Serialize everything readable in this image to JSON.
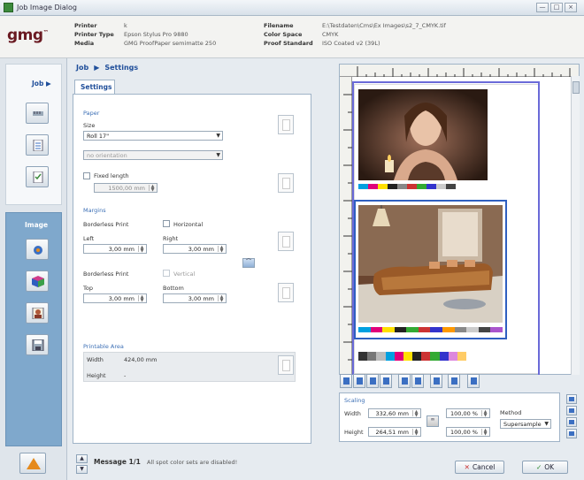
{
  "window": {
    "title": "Job Image Dialog",
    "min": "—",
    "max": "□",
    "close": "×"
  },
  "header": {
    "logo": "gmg",
    "printer_label": "Printer",
    "printer_value": "k",
    "printer_type_label": "Printer Type",
    "printer_type_value": "Epson Stylus Pro 9880",
    "media_label": "Media",
    "media_value": "GMG ProofPaper semimatte 250",
    "filename_label": "Filename",
    "filename_value": "E:\\Testdaten\\Cms\\Ex Images\\s2_7_CMYK.tif",
    "color_space_label": "Color Space",
    "color_space_value": "CMYK",
    "proof_standard_label": "Proof Standard",
    "proof_standard_value": "ISO Coated v2 (39L)"
  },
  "sidebar": {
    "job_label": "Job",
    "image_label": "Image"
  },
  "breadcrumb": {
    "job": "Job",
    "settings": "Settings"
  },
  "tab": {
    "settings": "Settings"
  },
  "paper": {
    "section": "Paper",
    "size_label": "Size",
    "size_value": "Roll 17\"",
    "orientation_value": "no orientation",
    "fixed_length_label": "Fixed length",
    "fixed_length_value": "1500,00 mm"
  },
  "margins": {
    "section": "Margins",
    "borderless_label": "Borderless Print",
    "horizontal_label": "Horizontal",
    "left_label": "Left",
    "left_value": "3,00 mm",
    "right_label": "Right",
    "right_value": "3,00 mm",
    "borderless2_label": "Borderless Print",
    "vertical_label": "Vertical",
    "top_label": "Top",
    "top_value": "3,00 mm",
    "bottom_label": "Bottom",
    "bottom_value": "3,00 mm"
  },
  "printable_area": {
    "section": "Printable Area",
    "width_label": "Width",
    "width_value": "424,00 mm",
    "height_label": "Height",
    "height_value": "-"
  },
  "scaling": {
    "section": "Scaling",
    "width_label": "Width",
    "width_value": "332,60 mm",
    "height_label": "Height",
    "height_value": "264,51 mm",
    "width_pct": "100,00 %",
    "height_pct": "100,00 %",
    "method_label": "Method",
    "method_value": "Supersample"
  },
  "message": {
    "label": "Message 1/1",
    "text": "All spot color sets are disabled!"
  },
  "buttons": {
    "cancel": "Cancel",
    "ok": "OK"
  },
  "colors": {
    "accent": "#1f4e9a",
    "frame": "#2f5fc0",
    "sidebar_image": "#7fa8cc"
  }
}
